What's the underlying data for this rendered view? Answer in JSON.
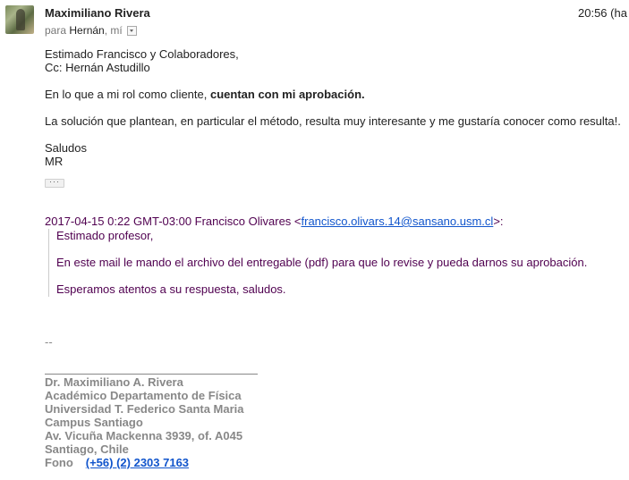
{
  "header": {
    "sender": "Maximiliano Rivera",
    "time": "20:56 (ha",
    "to_prefix": "para",
    "to_name": "Hernán",
    "to_sep": ",",
    "to_me": "mí"
  },
  "message": {
    "greeting": "Estimado Francisco y Colaboradores,",
    "cc": "Cc: Hernán Astudillo",
    "line1_plain": "En lo que a mi rol como cliente, ",
    "line1_bold": "cuentan con mi aprobación.",
    "line2": "La solución que plantean, en particular el método, resulta muy interesante y me gustaría conocer como resulta!.",
    "closing": "Saludos",
    "initials": "MR",
    "show_trimmed": "···"
  },
  "quoted": {
    "header_prefix": "2017-04-15 0:22 GMT-03:00 Francisco Olivares <",
    "email": "francisco.olivars.14@sansano.usm.cl",
    "header_suffix": ">:",
    "line1": "Estimado profesor,",
    "line2": "En este mail le mando el archivo del entregable (pdf) para que lo revise y pueda darnos su aprobación.",
    "line3": "Esperamos atentos a su respuesta, saludos."
  },
  "signature": {
    "dashes": "--",
    "name": "Dr. Maximiliano A. Rivera",
    "role": "Académico Departamento de Física",
    "university": "Universidad T. Federico Santa Maria",
    "campus": "Campus Santiago",
    "address": "Av. Vicuña Mackenna 3939, of. A045",
    "city": "Santiago, Chile",
    "phone_label": "Fono",
    "phone": "(+56) (2) 2303 7163"
  }
}
